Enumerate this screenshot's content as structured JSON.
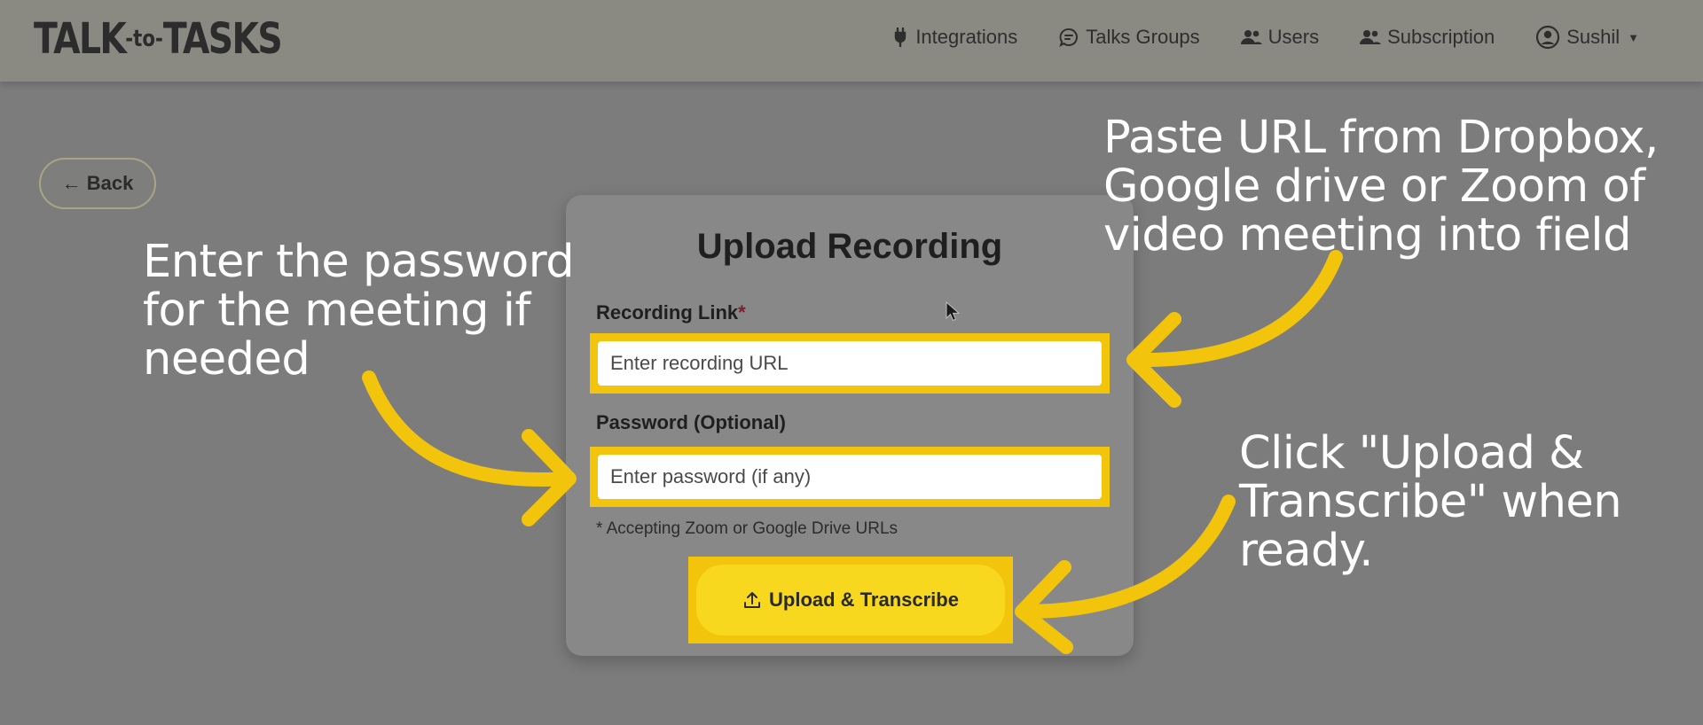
{
  "header": {
    "logo": {
      "left": "TALK",
      "mid": "-to-",
      "right": "TASKS"
    },
    "nav": [
      {
        "label": "Integrations",
        "icon": "plug-icon"
      },
      {
        "label": "Talks Groups",
        "icon": "chat-icon"
      },
      {
        "label": "Users",
        "icon": "users-icon"
      },
      {
        "label": "Subscription",
        "icon": "users-icon"
      },
      {
        "label": "Sushil",
        "icon": "user-circle-icon"
      }
    ]
  },
  "back_button": {
    "label": "← Back"
  },
  "form": {
    "title": "Upload Recording",
    "recording_link_label": "Recording Link",
    "required_mark": "*",
    "recording_placeholder": "Enter recording URL",
    "password_label": "Password (Optional)",
    "password_placeholder": "Enter password (if any)",
    "hint": "* Accepting Zoom or Google Drive URLs",
    "submit_label": "Upload & Transcribe",
    "submit_icon": "upload-icon"
  },
  "annotations": {
    "password": [
      "Enter the password",
      "for the meeting if",
      "needed"
    ],
    "url": [
      "Paste URL from Dropbox,",
      "Google drive or Zoom of",
      "video meeting into field"
    ],
    "upload": [
      "Click \"Upload &",
      "Transcribe\" when",
      "ready."
    ]
  },
  "colors": {
    "highlight": "#f2c40c",
    "button": "#f7d81e",
    "overlay": "#7c7c7c",
    "annotation_text": "#ffffff"
  }
}
